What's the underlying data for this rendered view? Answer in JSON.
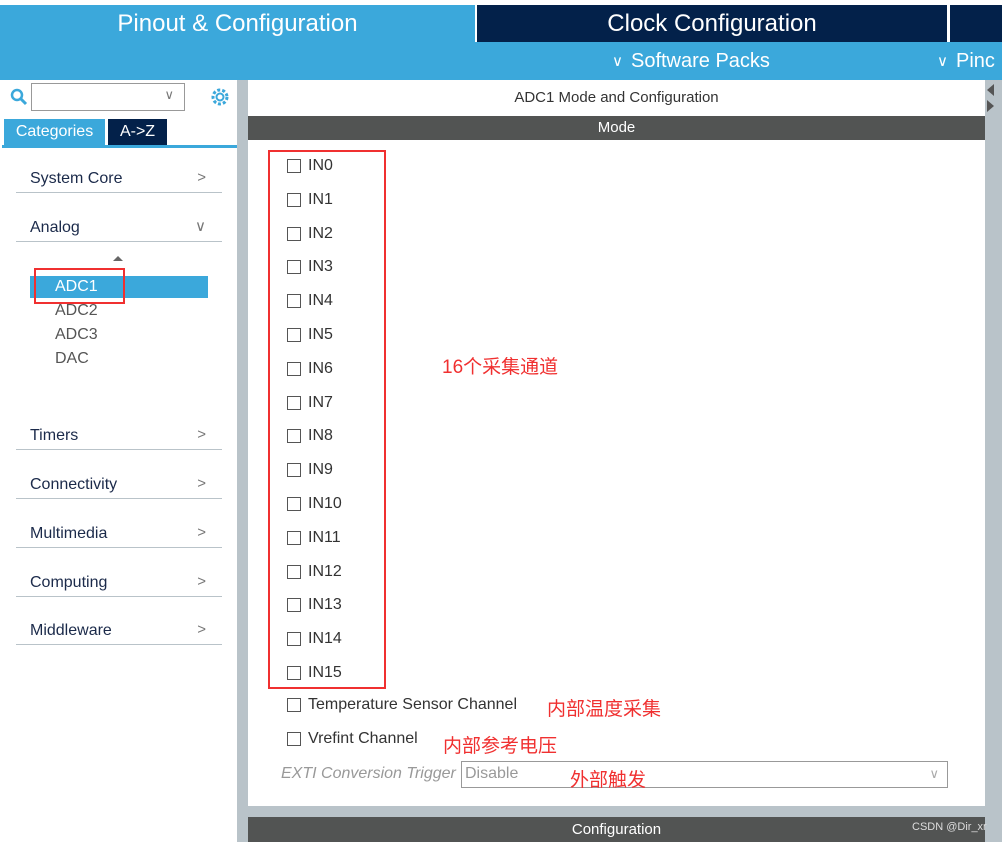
{
  "tabs": [
    {
      "label": "Pinout & Configuration",
      "active": true
    },
    {
      "label": "Clock Configuration",
      "active": false
    },
    {
      "label": "",
      "active": false
    }
  ],
  "subbar": {
    "software_packs": "Software Packs",
    "pinout": "Pinc"
  },
  "sidebar": {
    "search": {
      "value": "",
      "placeholder": ""
    },
    "view_tabs": [
      {
        "label": "Categories",
        "active": true
      },
      {
        "label": "A->Z",
        "active": false
      }
    ],
    "categories": [
      {
        "label": "System Core",
        "expanded": false
      },
      {
        "label": "Analog",
        "expanded": true,
        "items": [
          "ADC1",
          "ADC2",
          "ADC3",
          "DAC"
        ],
        "selected": "ADC1"
      },
      {
        "label": "Timers",
        "expanded": false
      },
      {
        "label": "Connectivity",
        "expanded": false
      },
      {
        "label": "Multimedia",
        "expanded": false
      },
      {
        "label": "Computing",
        "expanded": false
      },
      {
        "label": "Middleware",
        "expanded": false
      }
    ]
  },
  "main": {
    "title": "ADC1 Mode and Configuration",
    "mode_header": "Mode",
    "channels": [
      "IN0",
      "IN1",
      "IN2",
      "IN3",
      "IN4",
      "IN5",
      "IN6",
      "IN7",
      "IN8",
      "IN9",
      "IN10",
      "IN11",
      "IN12",
      "IN13",
      "IN14",
      "IN15"
    ],
    "temp_channel": "Temperature Sensor Channel",
    "vrefint_channel": "Vrefint Channel",
    "exti_label": "EXTI Conversion Trigger",
    "exti_value": "Disable",
    "config_header": "Configuration"
  },
  "annotations": {
    "channels": "16个采集通道",
    "temp": "内部温度采集",
    "vref": "内部参考电压",
    "exti": "外部触发",
    "watermark": "CSDN @Dir_xr"
  },
  "colors": {
    "tab_active": "#3ba8db",
    "tab_inactive": "#03214a",
    "header_dark": "#525453",
    "annotation": "#f03030"
  }
}
